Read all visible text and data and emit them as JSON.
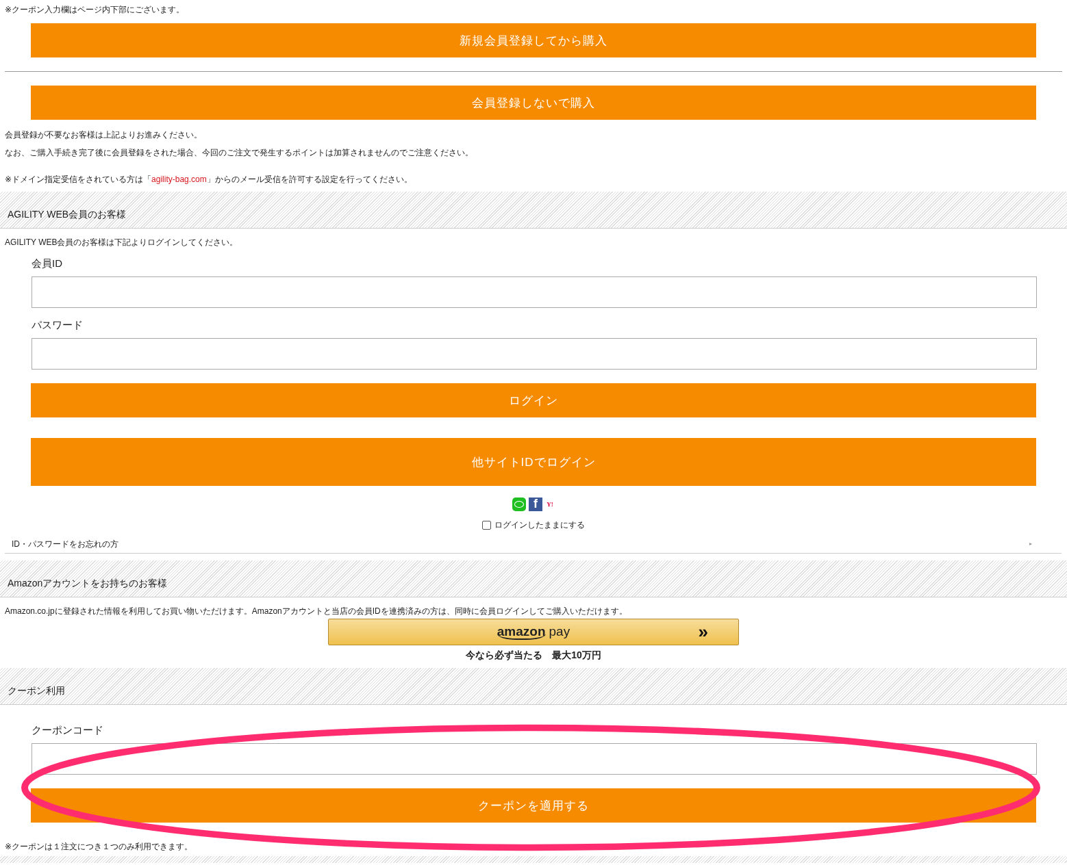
{
  "top_note": "※クーポン入力欄はページ内下部にございます。",
  "register_button": "新規会員登録してから購入",
  "guest_button": "会員登録しないで購入",
  "guest_notes": [
    "会員登録が不要なお客様は上記よりお進みください。",
    "なお、ご購入手続き完了後に会員登録をされた場合、今回のご注文で発生するポイントは加算されませんのでご注意ください。"
  ],
  "domain_note": {
    "before": "※ドメイン指定受信をされている方は「",
    "link": "agility-bag.com",
    "after": "」からのメール受信を許可する設定を行ってください。"
  },
  "member_section": {
    "title": "AGILITY WEB会員のお客様",
    "intro": "AGILITY WEB会員のお客様は下記よりログインしてください。",
    "fields": [
      {
        "label": "会員ID"
      },
      {
        "label": "パスワード"
      }
    ],
    "login_button": "ログイン",
    "social_button": "他サイトIDでログイン",
    "social_icons": [
      {
        "kind": "line"
      },
      {
        "kind": "facebook",
        "text": "f"
      },
      {
        "kind": "yahoo",
        "text": "Y!"
      }
    ],
    "remember": {
      "label": "ログインしたままにする",
      "checked": false
    },
    "forgot_link": "ID・パスワードをお忘れの方",
    "forgot_arrow": "▸"
  },
  "amazon_section": {
    "title": "Amazonアカウントをお持ちのお客様",
    "intro": "Amazon.co.jpに登録された情報を利用してお買い物いただけます。Amazonアカウントと当店の会員IDを連携済みの方は、同時に会員ログインしてご購入いただけます。",
    "button": {
      "brand": "amazon",
      "word": "pay",
      "arrow": "»"
    },
    "promo": "今なら必ず当たる　最大10万円"
  },
  "coupon_section": {
    "title": "クーポン利用",
    "label": "クーポンコード",
    "button": "クーポンを適用する",
    "note": "※クーポンは１注文につき１つのみ利用できます。"
  }
}
